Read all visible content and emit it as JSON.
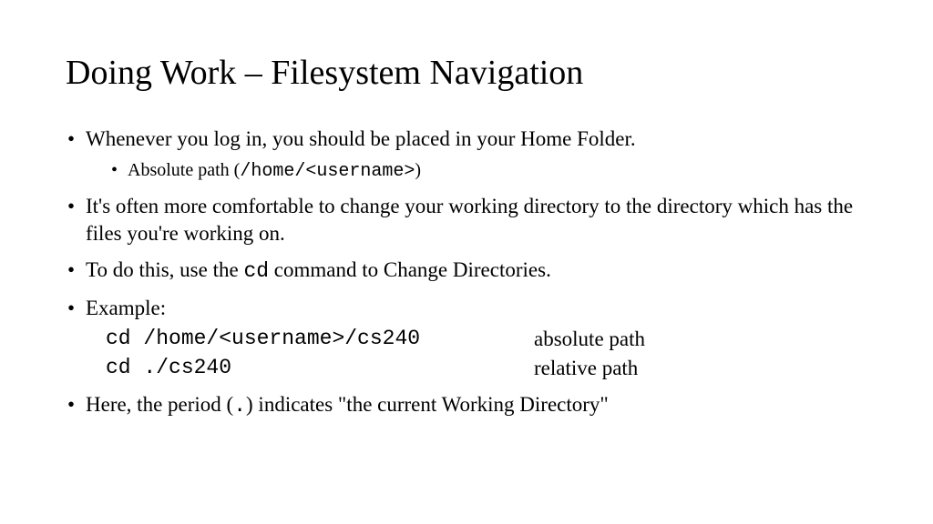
{
  "title": "Doing Work – Filesystem Navigation",
  "bullets": {
    "b1": "Whenever you log in, you should be placed in your Home Folder.",
    "b1_sub_prefix": "Absolute path (",
    "b1_sub_code": "/home/<username>",
    "b1_sub_suffix": ")",
    "b2": "It's often more comfortable to change your working directory to the directory which has the files you're working on.",
    "b3_prefix": "To do this, use the ",
    "b3_code": "cd",
    "b3_suffix": " command to Change Directories.",
    "b4": "Example:",
    "ex1_cmd": "cd /home/<username>/cs240",
    "ex1_desc": "absolute path",
    "ex2_cmd": "cd ./cs240",
    "ex2_desc": "relative path",
    "b5_prefix": "Here, the period (",
    "b5_code": ".",
    "b5_suffix": ") indicates \"the current Working Directory\""
  }
}
